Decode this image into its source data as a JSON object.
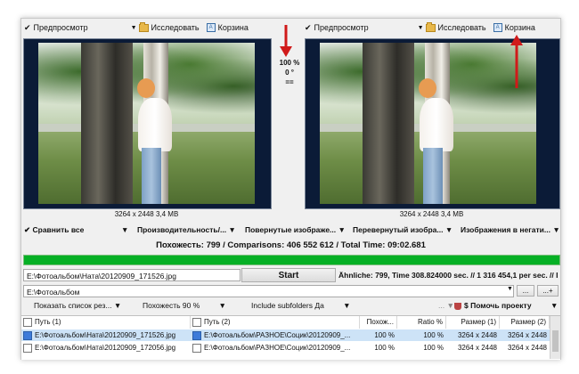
{
  "left_toolbar": {
    "preview_label": "Предпросмотр",
    "explore_label": "Исследовать",
    "trash_label": "Корзина"
  },
  "right_toolbar": {
    "preview_label": "Предпросмотр",
    "explore_label": "Исследовать",
    "trash_label": "Корзина"
  },
  "zoom": {
    "percent": "100 %",
    "angle": "0 °",
    "equal": "=="
  },
  "left_image": {
    "caption": "3264 x 2448 3,4 MB"
  },
  "right_image": {
    "caption": "3264 x 2448 3,4 MB"
  },
  "action_row": {
    "compare_all": "Сравнить все",
    "performance": "Производительность/...",
    "rotated": "Повернутые изображе...",
    "flipped": "Перевернутый изобра...",
    "negative": "Изображения в негати..."
  },
  "stats_text": "Похожесть: 799 / Comparisons: 406 552 612 / Total Time: 09:02.681",
  "progress_percent": 100,
  "current_file": "E:\\Фотоальбом\\Ната\\20120909_171526.jpg",
  "start_label": "Start",
  "status_text": "Ähnliche: 799, Time 308.824000 sec. // 1 316 454,1 per sec. //  I",
  "folder_path": "E:\\Фотоальбом",
  "folder_buttons": {
    "browse": "...",
    "add": "...+"
  },
  "options_row": {
    "show_results": "Показать список рез...",
    "similarity": "Похожесть 90 %",
    "subfolders": "Include subfolders Да",
    "help": "$ Помочь проекту",
    "ellipsis": "..."
  },
  "grid": {
    "headers": [
      "Путь (1)",
      "Путь (2)",
      "Похож...",
      "Ratio %",
      "Размер (1)",
      "Размер (2)"
    ],
    "rows": [
      {
        "path1": "E:\\Фотоальбом\\Ната\\20120909_171526.jpg",
        "path2": "E:\\Фотоальбом\\РАЗНОЕ\\Социк\\20120909_...",
        "similar": "100 %",
        "ratio": "100 %",
        "size1": "3264 x 2448",
        "size2": "3264 x 2448"
      },
      {
        "path1": "E:\\Фотоальбом\\Ната\\20120909_172056.jpg",
        "path2": "E:\\Фотоальбом\\РАЗНОЕ\\Социк\\20120909_...",
        "similar": "100 %",
        "ratio": "100 %",
        "size1": "3264 x 2448",
        "size2": "3264 x 2448"
      }
    ]
  },
  "colors": {
    "progress": "#06b025",
    "annotation_arrow": "#d01a1a",
    "image_frame": "#0b1b37"
  }
}
